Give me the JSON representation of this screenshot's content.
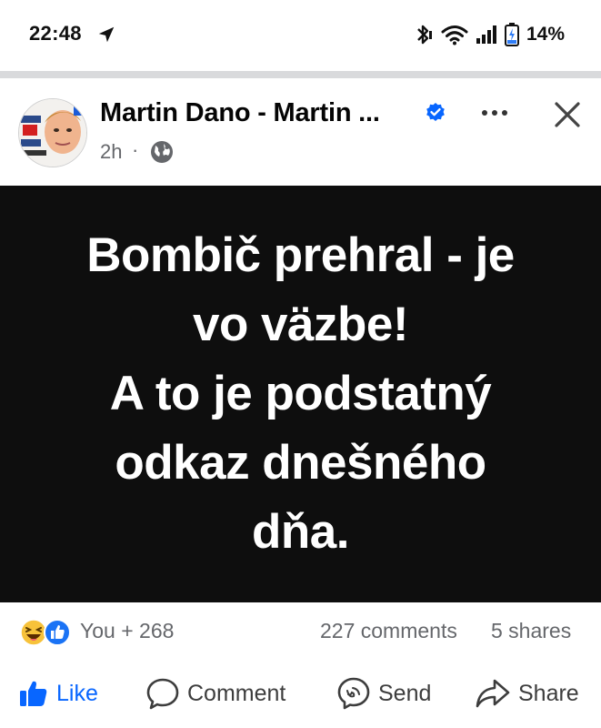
{
  "status_bar": {
    "time": "22:48",
    "battery": "14%",
    "icons": [
      "navigation-arrow-icon",
      "bluetooth-icon",
      "wifi-icon",
      "signal-icon",
      "battery-charging-icon"
    ]
  },
  "post": {
    "author": "Martin Dano - Martin ...",
    "verified": true,
    "time": "2h",
    "separator": "·",
    "audience_icon": "globe-icon",
    "image_text": [
      "Bombič prehral - je",
      "vo väzbe!",
      "A to je podstatný",
      "odkaz dnešného",
      "dňa."
    ],
    "image_background": "#0e0e0e"
  },
  "engagement": {
    "reactions": "You + 268",
    "comments": "227 comments",
    "shares": "5 shares",
    "reaction_icons": [
      "haha-reaction-icon",
      "like-reaction-icon"
    ]
  },
  "actions": {
    "like": "Like",
    "comment": "Comment",
    "send": "Send",
    "share": "Share"
  },
  "colors": {
    "accent": "#0866ff",
    "secondary_text": "#65676b",
    "verified": "#0866ff",
    "divider": "#d9dadc"
  }
}
